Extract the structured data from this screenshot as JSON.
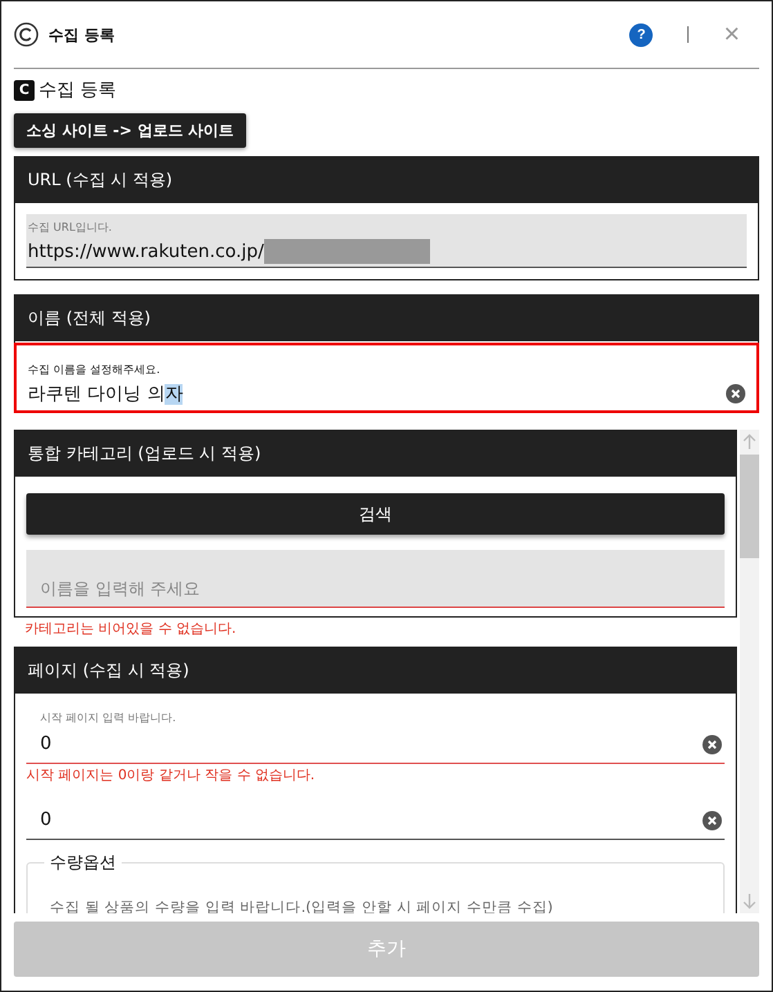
{
  "window": {
    "title": "수집 등록",
    "help": "?",
    "close": "×"
  },
  "heading": {
    "badge": "C",
    "title": "수집 등록"
  },
  "route_chip": "소싱 사이트 -> 업로드 사이트",
  "url_section": {
    "title": "URL (수집 시 적용)",
    "label": "수집 URL입니다.",
    "value": "https://www.rakuten.co.jp/",
    "redacted": true
  },
  "name_section": {
    "title": "이름 (전체 적용)",
    "label": "수집 이름을 설정해주세요.",
    "value": "라쿠텐 다이닝 의",
    "selected_text": "자",
    "invalid": true
  },
  "category_section": {
    "title": "통합 카테고리 (업로드 시 적용)",
    "search_button": "검색",
    "placeholder": "이름을 입력해 주세요",
    "error": "카테고리는 비어있을 수 없습니다."
  },
  "page_section": {
    "title": "페이지 (수집 시 적용)",
    "fields": [
      {
        "label": "시작 페이지 입력 바랍니다.",
        "value": "0",
        "error": "시작 페이지는 0이랑 같거나 작을 수 없습니다."
      },
      {
        "value": "0"
      }
    ],
    "quantity": {
      "legend": "수량옵션",
      "placeholder": "수집 될 상품의 수량을 입력 바랍니다.(입력을 안할 시 페이지 수만큼 수집)"
    }
  },
  "add_button": {
    "label": "추가",
    "disabled": true
  }
}
